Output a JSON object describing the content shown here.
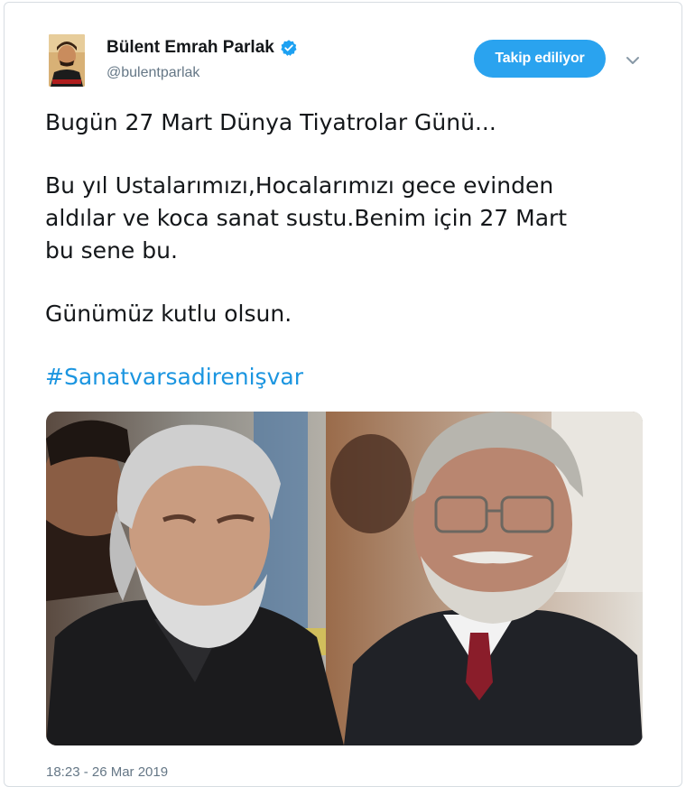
{
  "user": {
    "display_name": "Bülent Emrah Parlak",
    "handle": "@bulentparlak",
    "verified": true,
    "avatar_icon": "profile-photo"
  },
  "follow_button": {
    "label": "Takip ediliyor",
    "color": "#2aa3ef"
  },
  "menu_icon": "chevron-down-icon",
  "tweet": {
    "lines": [
      "Bugün 27 Mart Dünya Tiyatrolar Günü...",
      "Bu yıl Ustalarımızı,Hocalarımızı gece evinden",
      "aldılar ve koca sanat sustu.Benim için 27 Mart",
      "bu sene bu.",
      "Günümüz kutlu olsun."
    ],
    "hashtag": "#Sanatvarsadirenişvar",
    "hashtag_color": "#1b95e0"
  },
  "media": {
    "icon": "photo-two-men"
  },
  "timestamp": "18:23 - 26 Mar 2019"
}
